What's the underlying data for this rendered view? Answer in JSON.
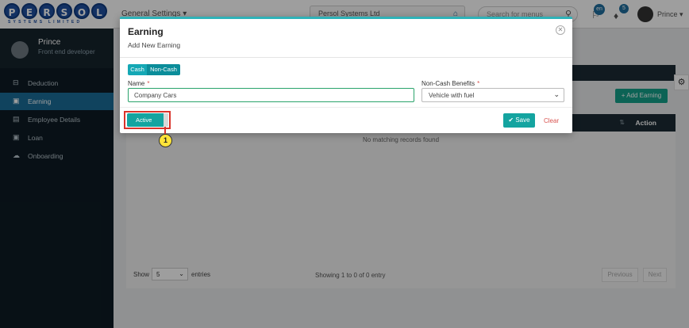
{
  "brand": {
    "letters": [
      "P",
      "E",
      "R",
      "S",
      "O",
      "L"
    ],
    "subtitle": "SYSTEMS LIMITED"
  },
  "topbar": {
    "menu_label": "General Settings ▾",
    "company": "Persol Systems Ltd",
    "search_placeholder": "Search for menus",
    "lang_badge": "en",
    "notif_count": "5",
    "user_name": "Prince ▾"
  },
  "sidebar": {
    "profile": {
      "name": "Prince",
      "role": "Front end developer"
    },
    "items": [
      {
        "label": "Deduction",
        "icon": "⊟"
      },
      {
        "label": "Earning",
        "icon": "▣"
      },
      {
        "label": "Employee Details",
        "icon": "▤"
      },
      {
        "label": "Loan",
        "icon": "▣"
      },
      {
        "label": "Onboarding",
        "icon": "☁"
      }
    ]
  },
  "main": {
    "add_button": "+ Add Earning",
    "table": {
      "action_header": "Action",
      "sort_icon": "⇅",
      "empty_text": "No matching records found"
    },
    "footer": {
      "show_label": "Show",
      "entries_value": "5",
      "entries_label": "entries",
      "showing_text": "Showing 1 to 0 of 0 entry",
      "prev": "Previous",
      "next": "Next"
    }
  },
  "modal": {
    "title": "Earning",
    "subtitle": "Add New Earning",
    "tabs": {
      "cash": "Cash",
      "non_cash": "Non-Cash"
    },
    "name_label": "Name",
    "name_value": "Company Cars",
    "benefits_label": "Non-Cash Benefits",
    "benefits_value": "Vehicle with fuel",
    "required_mark": "*",
    "active_label": "Active",
    "save_label": "✔ Save",
    "clear_label": "Clear"
  },
  "annotation": {
    "step": "1"
  },
  "colors": {
    "accent": "#14a4a0",
    "sidebar_active": "#1a6d98",
    "highlight": "#d9342b"
  }
}
